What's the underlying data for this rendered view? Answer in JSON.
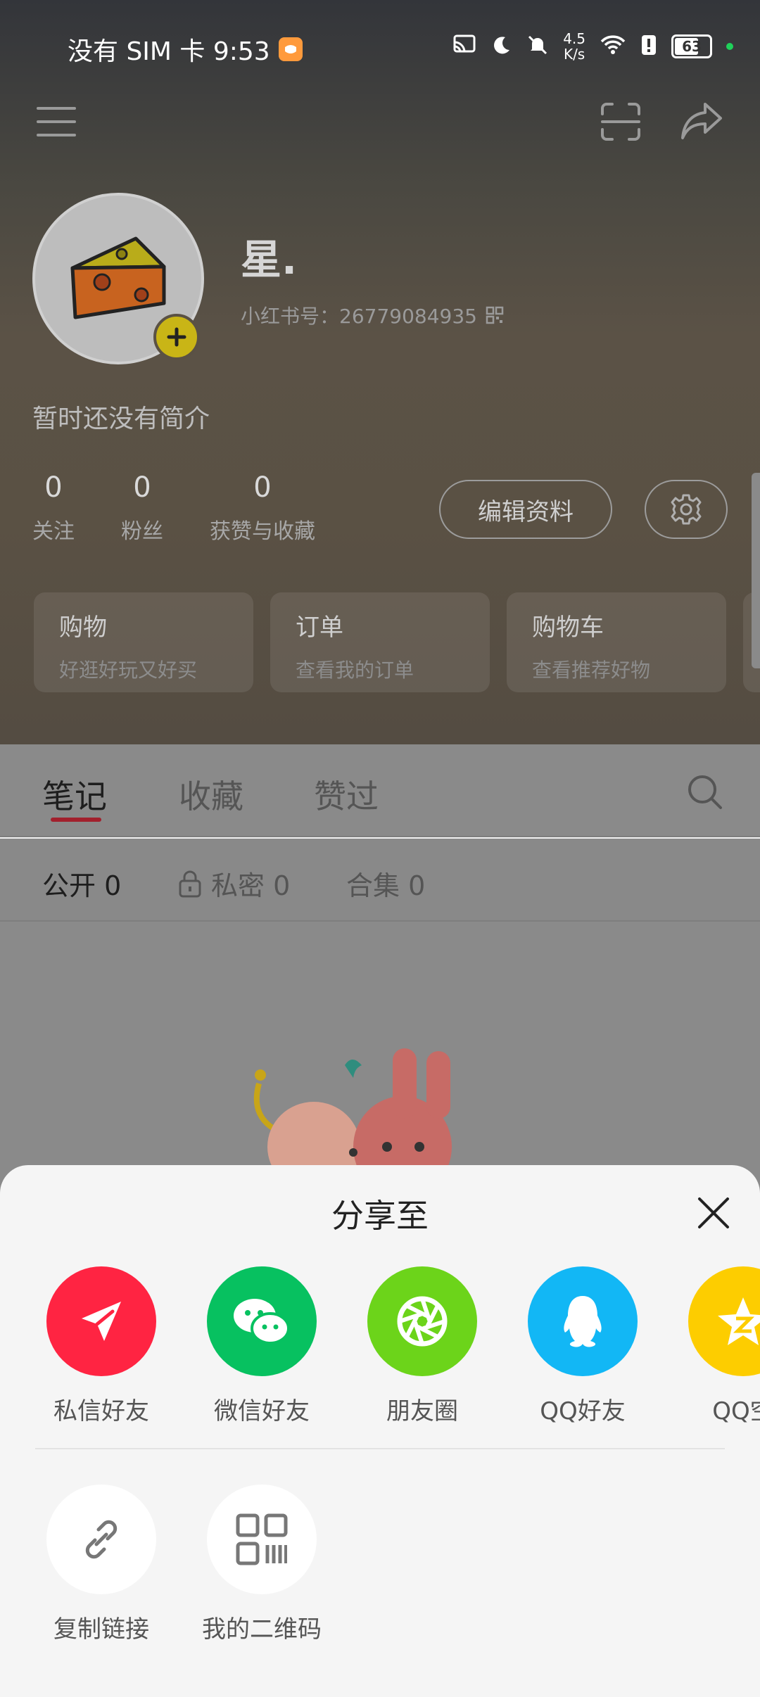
{
  "status_bar": {
    "carrier_time": "没有 SIM 卡 9:53",
    "net_speed_value": "4.5",
    "net_speed_unit": "K/s",
    "battery": "63"
  },
  "profile": {
    "nickname": "星.",
    "red_id_label": "小红书号：26779084935",
    "bio": "暂时还没有简介",
    "stats": [
      {
        "num": "0",
        "label": "关注"
      },
      {
        "num": "0",
        "label": "粉丝"
      },
      {
        "num": "0",
        "label": "获赞与收藏"
      }
    ],
    "edit_label": "编辑资料"
  },
  "cards": [
    {
      "title": "购物",
      "sub": "好逛好玩又好买"
    },
    {
      "title": "订单",
      "sub": "查看我的订单"
    },
    {
      "title": "购物车",
      "sub": "查看推荐好物"
    }
  ],
  "tabs": [
    "笔记",
    "收藏",
    "赞过"
  ],
  "subtabs": {
    "public": "公开 0",
    "private": "私密 0",
    "collection": "合集 0"
  },
  "share": {
    "title": "分享至",
    "items": [
      {
        "label": "私信好友",
        "color": "#ff2442"
      },
      {
        "label": "微信好友",
        "color": "#07c160"
      },
      {
        "label": "朋友圈",
        "color": "#6cd41a"
      },
      {
        "label": "QQ好友",
        "color": "#12b7f5"
      },
      {
        "label": "QQ空",
        "color": "#fdcd00"
      }
    ],
    "tools": [
      {
        "label": "复制链接"
      },
      {
        "label": "我的二维码"
      }
    ]
  }
}
